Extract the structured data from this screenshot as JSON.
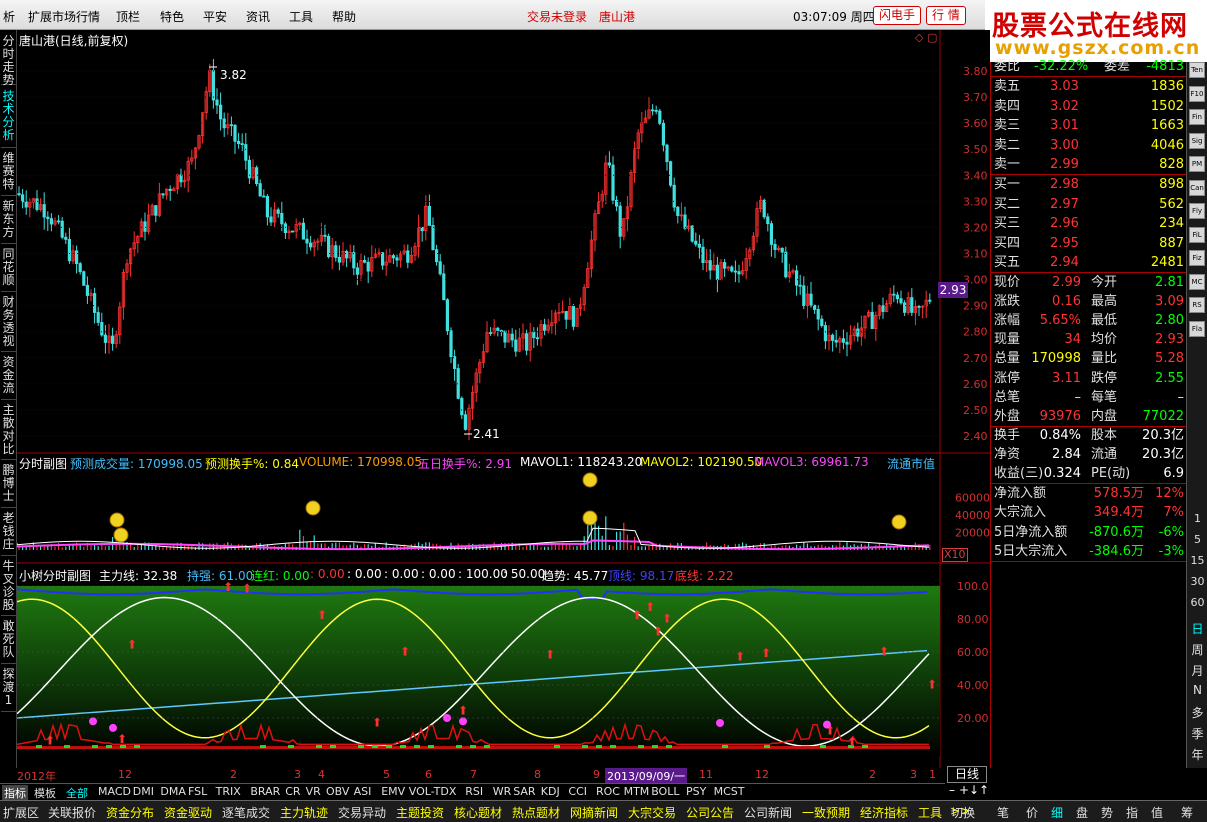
{
  "menu": {
    "items": [
      "析",
      "扩展市场行情",
      "顶栏",
      "特色",
      "平安",
      "资讯",
      "工具",
      "帮助"
    ],
    "trade_status": "交易未登录",
    "stock_name": "唐山港",
    "clock": "03:07:09 周四",
    "flash_btn": "闪电手",
    "quote_btn": "行 情"
  },
  "logo": {
    "cn": "股票公式在线网",
    "url": "www.gszx.com.cn"
  },
  "left_tabs": [
    "分时走势",
    "技术分析",
    "维赛特",
    "新东方",
    "同花顺",
    "财务透视",
    "资金流",
    "主散对比",
    "鹏博士",
    "老钱庄",
    "牛叉诊股",
    "敢死队",
    "探渡1"
  ],
  "main_chart": {
    "title": "唐山港(日线,前复权)",
    "high_label": "3.82",
    "low_label": "2.41",
    "current_price_tag": "2.93",
    "y_ticks": [
      "3.80",
      "3.70",
      "3.60",
      "3.50",
      "3.40",
      "3.30",
      "3.20",
      "3.10",
      "3.00",
      "2.90",
      "2.80",
      "2.70",
      "2.60",
      "2.50",
      "2.40"
    ]
  },
  "volume_panel": {
    "title": "分时副图",
    "f1_label": "预测成交量: 170998.05",
    "f2_label": "预测换手%: 0.84",
    "f3_label": "VOLUME: 170998.05",
    "f4_label": "五日换手%: 2.91",
    "f5_label": "MAVOL1: 118243.20",
    "f6_label": "MAVOL2: 102190.50",
    "f7_label": "MAVOL3: 69961.73",
    "right_label": "流通市值",
    "y_ticks": [
      "60000",
      "40000",
      "20000"
    ],
    "scale": "X10"
  },
  "osc_panel": {
    "title": "小树分时副图",
    "main_line": "主力线: 32.38",
    "hold": "持强: 61.00",
    "lianhong": "连红: 0.00",
    "v1": ": 0.00",
    "v2": ": 0.00",
    "v3": ": 0.00",
    "v4": ": 0.00",
    "v5": ": 100.00",
    "v6": ": 50.00",
    "trend": "趋势: 45.77",
    "top_line": "顶线: 98.17",
    "bottom_line": "底线: 2.22",
    "y_ticks": [
      "100.0",
      "80.00",
      "60.00",
      "40.00",
      "20.00"
    ]
  },
  "quote": {
    "ratio": {
      "label": "委比",
      "value": "-32.22%",
      "label2": "委差",
      "value2": "-4813"
    },
    "asks": [
      {
        "label": "卖五",
        "price": "3.03",
        "vol": "1836"
      },
      {
        "label": "卖四",
        "price": "3.02",
        "vol": "1502"
      },
      {
        "label": "卖三",
        "price": "3.01",
        "vol": "1663"
      },
      {
        "label": "卖二",
        "price": "3.00",
        "vol": "4046"
      },
      {
        "label": "卖一",
        "price": "2.99",
        "vol": "828"
      }
    ],
    "bids": [
      {
        "label": "买一",
        "price": "2.98",
        "vol": "898"
      },
      {
        "label": "买二",
        "price": "2.97",
        "vol": "562"
      },
      {
        "label": "买三",
        "price": "2.96",
        "vol": "234"
      },
      {
        "label": "买四",
        "price": "2.95",
        "vol": "887"
      },
      {
        "label": "买五",
        "price": "2.94",
        "vol": "2481"
      }
    ],
    "stats": [
      {
        "l1": "现价",
        "v1": "2.99",
        "c1": "#ff3333",
        "l2": "今开",
        "v2": "2.81",
        "c2": "#00ff00"
      },
      {
        "l1": "涨跌",
        "v1": "0.16",
        "c1": "#ff3333",
        "l2": "最高",
        "v2": "3.09",
        "c2": "#ff3333"
      },
      {
        "l1": "涨幅",
        "v1": "5.65%",
        "c1": "#ff3333",
        "l2": "最低",
        "v2": "2.80",
        "c2": "#00ff00"
      },
      {
        "l1": "现量",
        "v1": "34",
        "c1": "#ff3333",
        "l2": "均价",
        "v2": "2.93",
        "c2": "#ff3333"
      },
      {
        "l1": "总量",
        "v1": "170998",
        "c1": "#ffff00",
        "l2": "量比",
        "v2": "5.28",
        "c2": "#ff3333"
      },
      {
        "l1": "涨停",
        "v1": "3.11",
        "c1": "#ff3333",
        "l2": "跌停",
        "v2": "2.55",
        "c2": "#00ff00"
      },
      {
        "l1": "总笔",
        "v1": "–",
        "c1": "#e0e0e0",
        "l2": "每笔",
        "v2": "–",
        "c2": "#e0e0e0"
      },
      {
        "l1": "外盘",
        "v1": "93976",
        "c1": "#ff3333",
        "l2": "内盘",
        "v2": "77022",
        "c2": "#00ff00"
      }
    ],
    "fund": [
      {
        "l1": "换手",
        "v1": "0.84%",
        "l2": "股本",
        "v2": "20.3亿"
      },
      {
        "l1": "净资",
        "v1": "2.84",
        "l2": "流通",
        "v2": "20.3亿"
      },
      {
        "l1": "收益(三)",
        "v1": "0.324",
        "l2": "PE(动)",
        "v2": "6.9"
      }
    ],
    "flow": [
      {
        "label": "净流入额",
        "value": "578.5万",
        "pct": "12%",
        "color": "#ff3333"
      },
      {
        "label": "大宗流入",
        "value": "349.4万",
        "pct": "7%",
        "color": "#ff3333"
      },
      {
        "label": "5日净流入额",
        "value": "-870.6万",
        "pct": "-6%",
        "color": "#00ff00"
      },
      {
        "label": "5日大宗流入",
        "value": "-384.6万",
        "pct": "-3%",
        "color": "#00ff00"
      }
    ]
  },
  "tool_strip": {
    "icons": [
      "Ten",
      "F10",
      "Fin",
      "Sig",
      "PM",
      "Can",
      "Fly",
      "FiL",
      "Fiz",
      "MC",
      "RS",
      "Fla"
    ],
    "numbers": [
      "1",
      "5",
      "15",
      "30",
      "60"
    ],
    "periods": [
      "日",
      "周",
      "月",
      "N",
      "多",
      "季",
      "年"
    ]
  },
  "date_axis": {
    "labels": [
      "2012年",
      "12",
      "2",
      "3",
      "4",
      "5",
      "6",
      "7",
      "8",
      "9",
      "11",
      "12",
      "2",
      "3",
      "1"
    ],
    "highlight": "2013/09/09/一"
  },
  "period_box": "日线",
  "nav_arrows": [
    "–",
    "+",
    "↓",
    "↑"
  ],
  "indicator_tabs": [
    "指标",
    "模板",
    "全部",
    "MACD",
    "DMI",
    "DMA",
    "FSL",
    "TRIX",
    "BRAR",
    "CR",
    "VR",
    "OBV",
    "ASI",
    "EMV",
    "VOL-TDX",
    "RSI",
    "WR",
    "SAR",
    "KDJ",
    "CCI",
    "ROC",
    "MTM",
    "BOLL",
    "PSY",
    "MCST"
  ],
  "bottom_nav": [
    {
      "t": "扩展区",
      "c": "#e0e0e0"
    },
    {
      "t": "关联报价",
      "c": "#e0e0e0"
    },
    {
      "t": "资金分布",
      "c": "#ffff00"
    },
    {
      "t": "资金驱动",
      "c": "#ffff00"
    },
    {
      "t": "逐笔成交",
      "c": "#e0e0e0"
    },
    {
      "t": "主力轨迹",
      "c": "#ffff00"
    },
    {
      "t": "交易异动",
      "c": "#e0e0e0"
    },
    {
      "t": "主题投资",
      "c": "#ffff00"
    },
    {
      "t": "核心题材",
      "c": "#ffff00"
    },
    {
      "t": "热点题材",
      "c": "#ffff00"
    },
    {
      "t": "网摘新闻",
      "c": "#ffff00"
    },
    {
      "t": "大宗交易",
      "c": "#ffff00"
    },
    {
      "t": "公司公告",
      "c": "#ffff00"
    },
    {
      "t": "公司新闻",
      "c": "#e0e0e0"
    },
    {
      "t": "一致预期",
      "c": "#ffff00"
    },
    {
      "t": "经济指标",
      "c": "#ffff00"
    },
    {
      "t": "工具",
      "c": "#ffff00"
    },
    {
      "t": ">>",
      "c": "#ffff00"
    }
  ],
  "bottom_right": [
    "切换",
    "笔",
    "价",
    "细",
    "盘",
    "势",
    "指",
    "值",
    "筹"
  ]
}
